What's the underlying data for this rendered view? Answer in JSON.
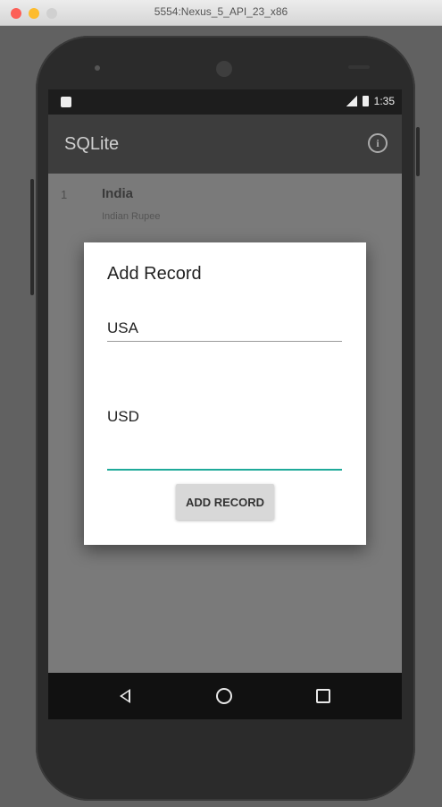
{
  "window": {
    "title": "5554:Nexus_5_API_23_x86"
  },
  "status_bar": {
    "time": "1:35"
  },
  "app_bar": {
    "title": "SQLite"
  },
  "list": {
    "items": [
      {
        "number": "1",
        "name": "India",
        "subtitle": "Indian Rupee"
      }
    ]
  },
  "dialog": {
    "title": "Add Record",
    "field1_value": "USA",
    "field2_value": "USD",
    "field3_value": "",
    "button_label": "ADD RECORD",
    "accent_color": "#1faa9a"
  }
}
